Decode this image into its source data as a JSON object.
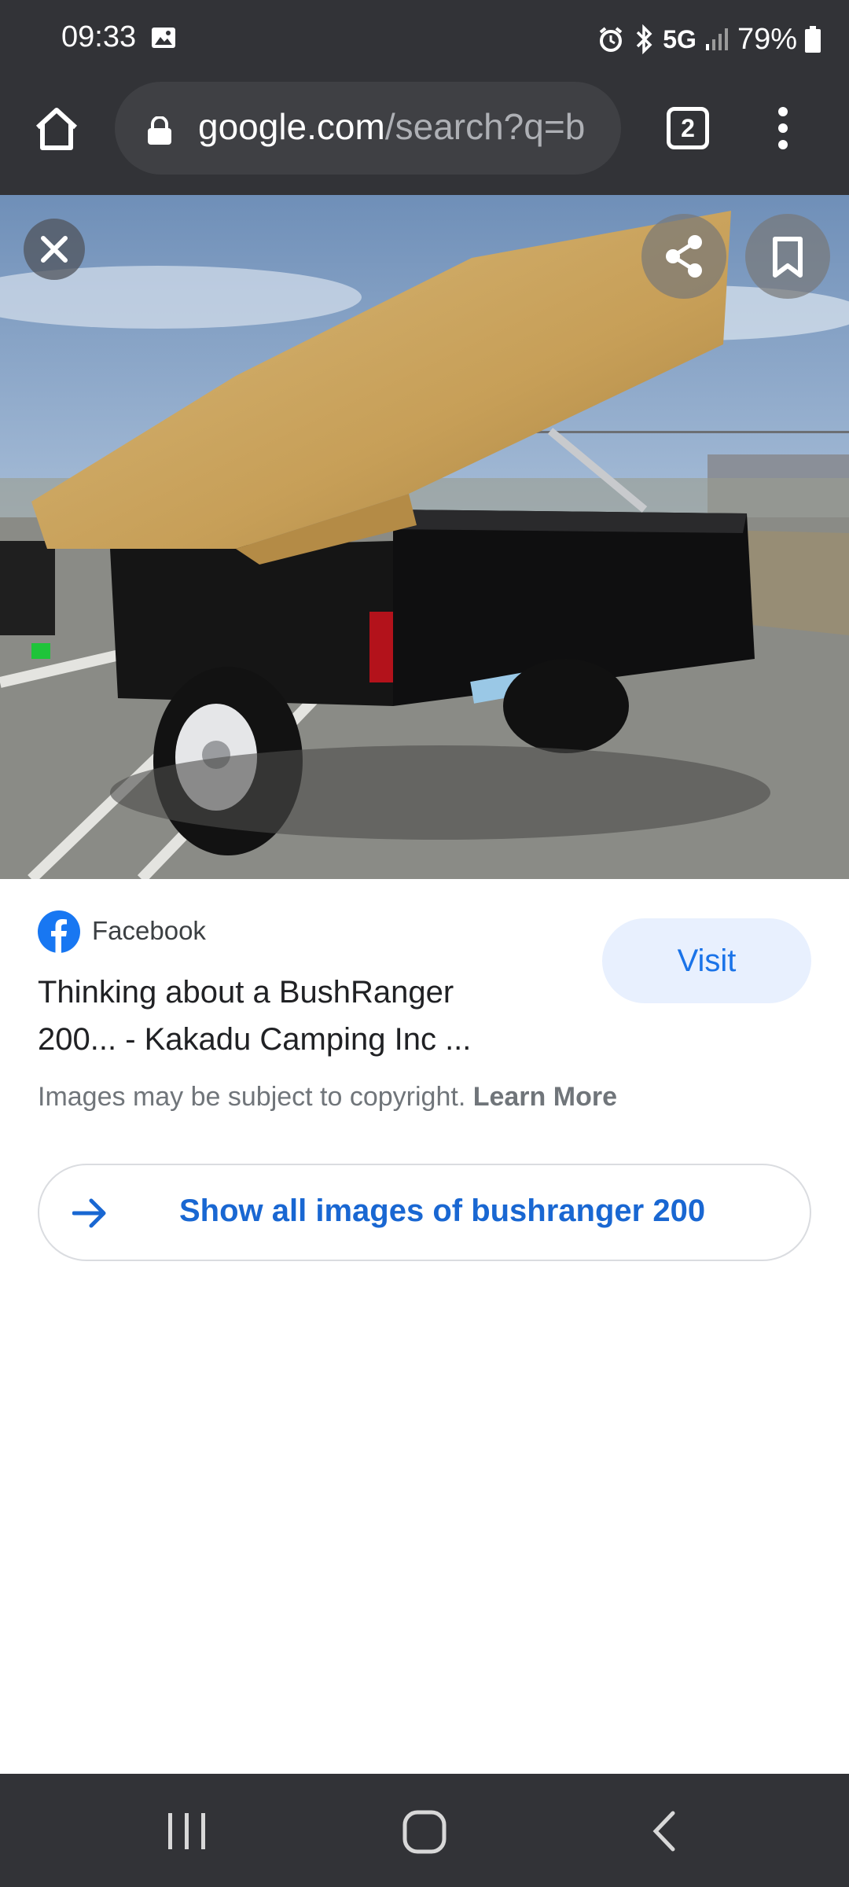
{
  "status_bar": {
    "time": "09:33",
    "network": "5G",
    "battery": "79%",
    "icons": [
      "image-icon",
      "alarm-icon",
      "bluetooth-icon",
      "signal-icon",
      "battery-icon"
    ]
  },
  "browser": {
    "url_domain": "google.com",
    "url_path": "/search?q=b",
    "tab_count": "2"
  },
  "image_viewer": {
    "image_subject": "black utility trailer with tan tent cover",
    "buttons": [
      "close-icon",
      "share-icon",
      "bookmark-icon"
    ]
  },
  "result": {
    "source": "Facebook",
    "title": "Thinking about a BushRanger 200... - Kakadu Camping Inc ...",
    "visit_label": "Visit",
    "copyright_text": "Images may be subject to copyright.",
    "learn_more": "Learn More",
    "show_all_label": "Show all images of bushranger 200"
  },
  "colors": {
    "chrome_dark": "#323337",
    "accent_blue": "#1a73e8",
    "visit_bg": "#e8f0fe",
    "facebook_blue": "#1877f2"
  }
}
